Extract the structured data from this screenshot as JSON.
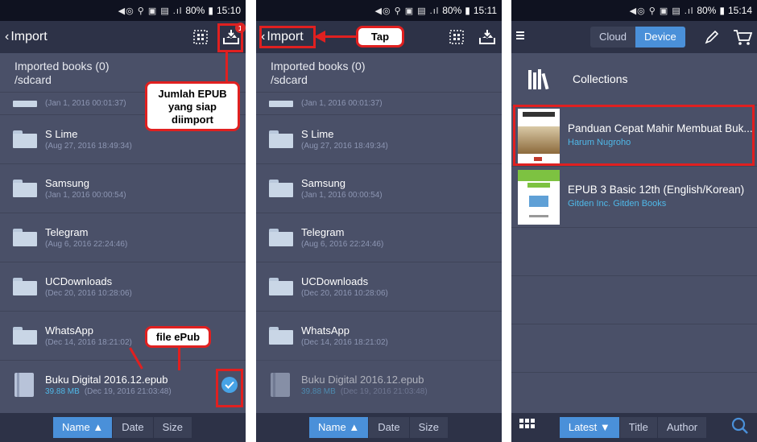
{
  "panel1": {
    "status": {
      "battery": "80%",
      "time": "15:10"
    },
    "appbar": {
      "back_label": "Import",
      "badge_count": "1"
    },
    "path": {
      "title": "Imported books (0)",
      "dir": "/sdcard"
    },
    "partial_row": {
      "meta": "(Jan 1, 2016 00:01:37)"
    },
    "folders": [
      {
        "name": "S Lime",
        "meta": "(Aug 27, 2016 18:49:34)"
      },
      {
        "name": "Samsung",
        "meta": "(Jan 1, 2016 00:00:54)"
      },
      {
        "name": "Telegram",
        "meta": "(Aug 6, 2016 22:24:46)"
      },
      {
        "name": "UCDownloads",
        "meta": "(Dec 20, 2016 10:28:06)"
      },
      {
        "name": "WhatsApp",
        "meta": "(Dec 14, 2016 18:21:02)"
      }
    ],
    "epub": {
      "name": "Buku Digital 2016.12.epub",
      "size": "39.88 MB",
      "date": "(Dec 19, 2016 21:03:48)"
    },
    "sort": {
      "name": "Name ▲",
      "date": "Date",
      "size": "Size"
    },
    "callout_import": "Jumlah EPUB yang siap diimport",
    "callout_file": "file ePub"
  },
  "panel2": {
    "status": {
      "battery": "80%",
      "time": "15:11"
    },
    "appbar": {
      "back_label": "Import"
    },
    "path": {
      "title": "Imported books (0)",
      "dir": "/sdcard"
    },
    "partial_row": {
      "meta": "(Jan 1, 2016 00:01:37)"
    },
    "folders": [
      {
        "name": "S Lime",
        "meta": "(Aug 27, 2016 18:49:34)"
      },
      {
        "name": "Samsung",
        "meta": "(Jan 1, 2016 00:00:54)"
      },
      {
        "name": "Telegram",
        "meta": "(Aug 6, 2016 22:24:46)"
      },
      {
        "name": "UCDownloads",
        "meta": "(Dec 20, 2016 10:28:06)"
      },
      {
        "name": "WhatsApp",
        "meta": "(Dec 14, 2016 18:21:02)"
      }
    ],
    "epub": {
      "name": "Buku Digital 2016.12.epub",
      "size": "39.88 MB",
      "date": "(Dec 19, 2016 21:03:48)"
    },
    "sort": {
      "name": "Name ▲",
      "date": "Date",
      "size": "Size"
    },
    "callout_tap": "Tap"
  },
  "panel3": {
    "status": {
      "battery": "80%",
      "time": "15:14"
    },
    "toggle": {
      "cloud": "Cloud",
      "device": "Device"
    },
    "collections_label": "Collections",
    "books": [
      {
        "title": "Panduan Cepat Mahir Membuat Buk...",
        "author": "Harum Nugroho"
      },
      {
        "title": "EPUB 3 Basic 12th (English/Korean)",
        "author": "Gitden Inc.  Gitden Books"
      }
    ],
    "sort": {
      "latest": "Latest ▼",
      "title": "Title",
      "author": "Author"
    }
  },
  "colors": {
    "accent": "#4a90d9",
    "panel_bg": "#4a5068",
    "bar_bg": "#2d3247",
    "highlight": "#e02020",
    "link": "#4fb8e8"
  }
}
